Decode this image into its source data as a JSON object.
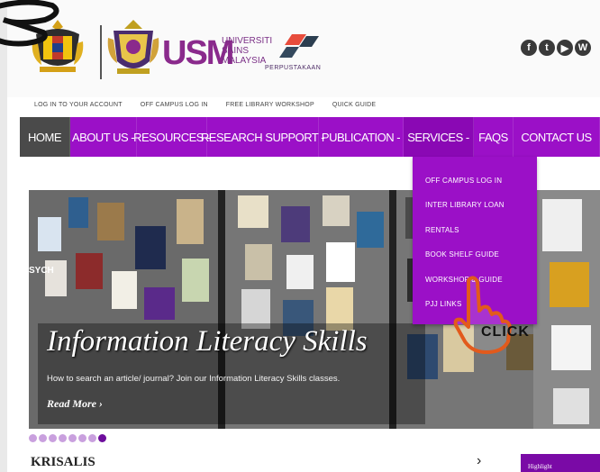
{
  "header": {
    "logo_short": "USM",
    "logo_text_lines": [
      "UNIVERSITI",
      "SAINS",
      "MALAYSIA"
    ],
    "library_label": "PERPUSTAKAAN",
    "socials": [
      "f",
      "t",
      "▶",
      "W"
    ]
  },
  "top_links": [
    "LOG IN TO YOUR ACCOUNT",
    "OFF CAMPUS LOG IN",
    "FREE LIBRARY WORKSHOP",
    "QUICK GUIDE"
  ],
  "nav": [
    {
      "label": "HOME"
    },
    {
      "label": "ABOUT US -"
    },
    {
      "label": "RESOURCES -"
    },
    {
      "label": "RESEARCH SUPPORT -"
    },
    {
      "label": "PUBLICATION -"
    },
    {
      "label": "SERVICES -"
    },
    {
      "label": "FAQS"
    },
    {
      "label": "CONTACT US"
    }
  ],
  "services_menu": [
    "OFF CAMPUS LOG IN",
    "INTER LIBRARY LOAN",
    "RENTALS",
    "BOOK SHELF GUIDE",
    "WORKSHOP & GUIDE",
    "PJJ LINKS"
  ],
  "slider": {
    "title": "Information Literacy Skills",
    "description": "How to search an article/ journal? Join our Information Literacy Skills classes.",
    "read_more": "Read More ›",
    "side_text": "SYCH",
    "dot_count": 8,
    "active_dot": 8
  },
  "section": {
    "title": "KRISALIS",
    "next": "›",
    "highlight_label": "Highlight"
  },
  "annotation": {
    "click_label": "CLICK"
  }
}
